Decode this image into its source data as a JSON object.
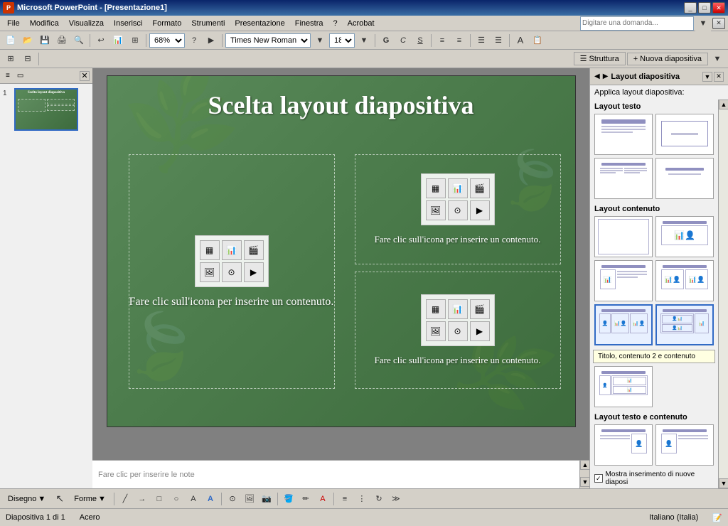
{
  "titlebar": {
    "title": "Microsoft PowerPoint - [Presentazione1]",
    "app_icon": "P"
  },
  "menubar": {
    "items": [
      "File",
      "Modifica",
      "Visualizza",
      "Inserisci",
      "Formato",
      "Strumenti",
      "Presentazione",
      "Finestra",
      "?",
      "Acrobat"
    ]
  },
  "toolbar1": {
    "zoom_value": "68%",
    "font_name": "Times New Roman",
    "font_size": "18",
    "search_placeholder": "Digitare una domanda..."
  },
  "toolbar2": {
    "struttura_label": "Struttura",
    "nuova_diapositiva_label": "Nuova diapositiva"
  },
  "slide": {
    "title": "Scelta layout diapositiva",
    "content_placeholder": "Fare clic sull'icona per inserire un contenuto.",
    "content_placeholder2": "Fare clic sull'icona per inserire un contenuto.",
    "content_placeholder3": "Fare clic sull'icona per inserire un contenuto."
  },
  "slide_thumbnail": {
    "number": "1",
    "title": "Scelta layout diapositiva"
  },
  "right_panel": {
    "title": "Layout diapositiva",
    "subtitle": "Applica layout diapositiva:",
    "section1": "Layout testo",
    "section2": "Layout contenuto",
    "section3": "Layout testo e contenuto",
    "tooltip": "Titolo, contenuto 2 e contenuto"
  },
  "notes_area": {
    "placeholder": "Fare clic per inserire le note"
  },
  "statusbar": {
    "slide_info": "Diapositiva 1 di 1",
    "theme": "Acero",
    "language": "Italiano (Italia)"
  },
  "drawing_bar": {
    "disegno_label": "Disegno",
    "forme_label": "Forme"
  },
  "checkbox": {
    "label": "Mostra inserimento di nuove diaposi"
  }
}
